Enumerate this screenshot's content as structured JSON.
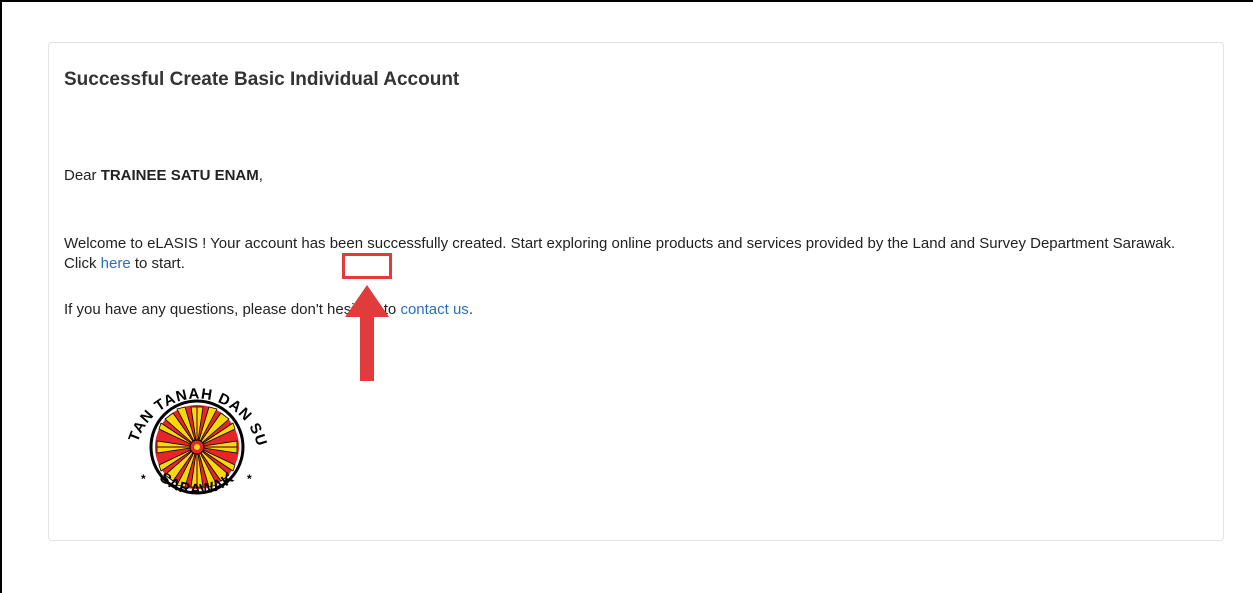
{
  "card": {
    "title": "Successful Create Basic Individual Account",
    "greeting_prefix": "Dear ",
    "recipient_name": "TRAINEE SATU ENAM",
    "greeting_suffix": ",",
    "welcome_text_before_link": "Welcome to eLASIS ! Your account has been successfully created. Start exploring online products and services provided by the Land and Survey Department Sarawak. Click ",
    "here_link": "here",
    "welcome_text_after_link": " to start.",
    "questions_text_before_link": "If you have any questions, please don't hesitate to ",
    "contact_link": "contact us",
    "questions_text_after_link": "."
  },
  "logo": {
    "text_top": "JABATAN TANAH DAN SURVEI",
    "text_bottom": "SARAWAK",
    "ring_color": "#000000",
    "disc_color": "#e8242b",
    "rays_color": "#f5d90a"
  },
  "annotation": {
    "highlight_color": "#e03c3c"
  }
}
